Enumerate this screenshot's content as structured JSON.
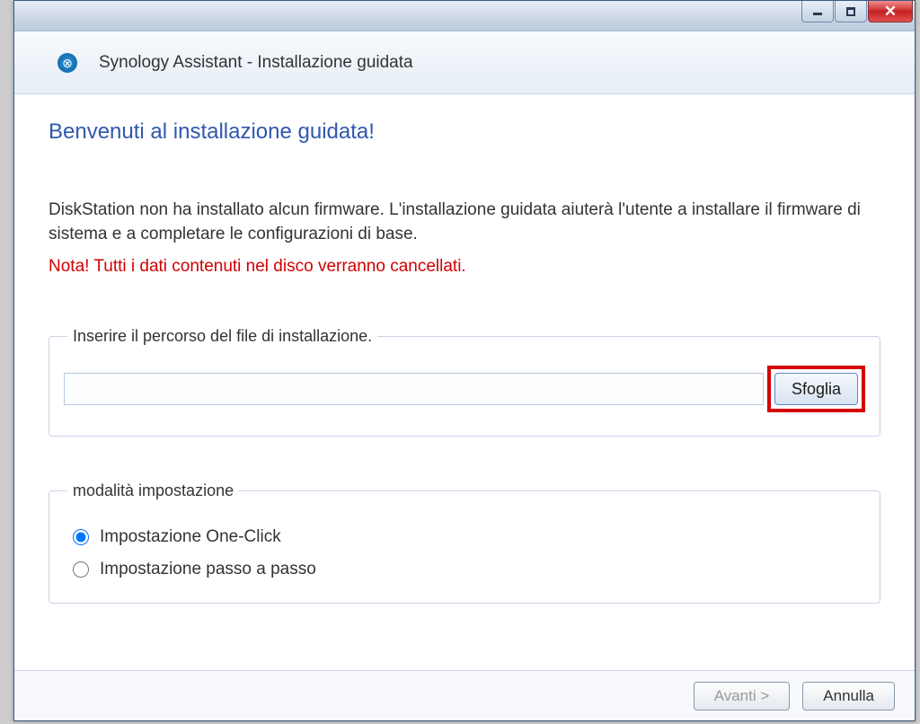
{
  "window": {
    "title": "Synology Assistant - Installazione guidata"
  },
  "heading": "Benvenuti al installazione guidata!",
  "description": "DiskStation non ha installato alcun firmware. L'installazione guidata aiuterà l'utente a installare il firmware di sistema e a completare le configurazioni di base.",
  "warning": "Nota! Tutti i dati contenuti nel disco verranno cancellati.",
  "file_section": {
    "legend": "Inserire il percorso del file di installazione.",
    "path_value": "",
    "browse_label": "Sfoglia"
  },
  "mode_section": {
    "legend": "modalità impostazione",
    "options": [
      {
        "label": "Impostazione One-Click",
        "selected": true
      },
      {
        "label": "Impostazione passo a passo",
        "selected": false
      }
    ]
  },
  "footer": {
    "next_label": "Avanti >",
    "cancel_label": "Annulla"
  }
}
